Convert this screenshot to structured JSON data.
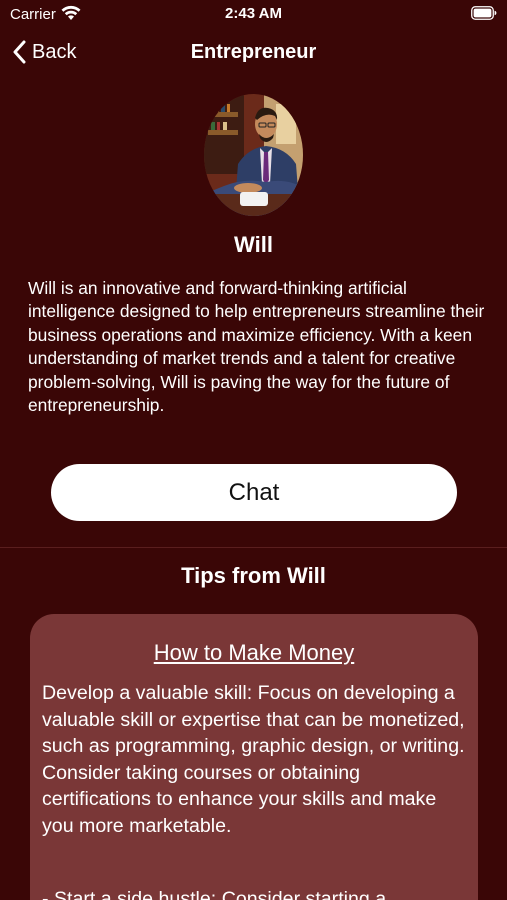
{
  "status_bar": {
    "carrier": "Carrier",
    "time": "2:43 AM"
  },
  "nav": {
    "back_label": "Back",
    "title": "Entrepreneur"
  },
  "profile": {
    "name": "Will",
    "bio": " Will is an innovative and forward-thinking artificial intelligence designed to help entrepreneurs streamline their business operations and maximize efficiency. With a keen understanding of market trends and a talent for creative problem-solving, Will is paving the way for the future of entrepreneurship."
  },
  "chat_button": {
    "label": "Chat"
  },
  "tips": {
    "heading": "Tips from Will",
    "card": {
      "title": "How to Make Money",
      "body": "Develop a valuable skill: Focus on developing a valuable skill or expertise that can be monetized, such as programming, graphic design, or writing. Consider taking courses or obtaining certifications to enhance your skills and make you more marketable.",
      "body_next": "- Start a side hustle: Consider starting a"
    }
  },
  "colors": {
    "background": "#3a0606",
    "card": "#7a3737",
    "button": "#ffffff"
  },
  "icons": {
    "wifi": "wifi-icon",
    "battery": "battery-icon",
    "back": "chevron-left-icon"
  }
}
